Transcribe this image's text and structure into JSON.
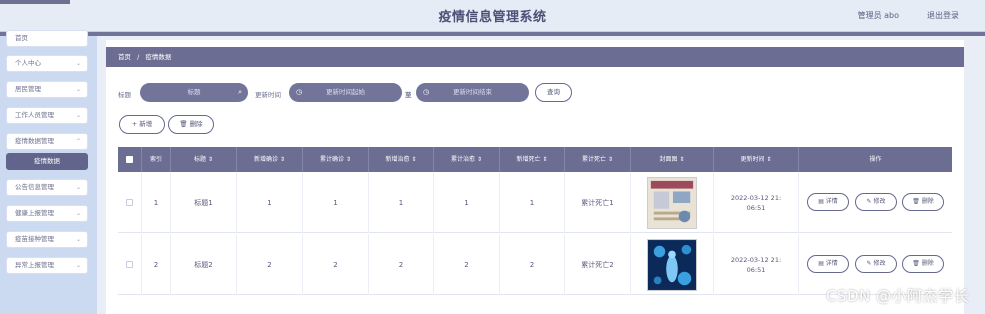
{
  "header": {
    "title": "疫情信息管理系统",
    "admin": "管理员 abo",
    "logout": "退出登录"
  },
  "sidebar": {
    "items": [
      {
        "label": "首页",
        "chev": ""
      },
      {
        "label": "个人中心",
        "chev": "⌄"
      },
      {
        "label": "居民管理",
        "chev": "⌄"
      },
      {
        "label": "工作人员管理",
        "chev": "⌄"
      },
      {
        "label": "疫情数据管理",
        "chev": "⌃"
      },
      {
        "label": "疫情数据",
        "chev": ""
      },
      {
        "label": "公告信息管理",
        "chev": "⌄"
      },
      {
        "label": "健康上报管理",
        "chev": "⌄"
      },
      {
        "label": "疫苗接种管理",
        "chev": "⌄"
      },
      {
        "label": "异常上报管理",
        "chev": "⌄"
      }
    ]
  },
  "breadcrumb": {
    "home": "首页",
    "sep": "/",
    "current": "疫情数据"
  },
  "filter": {
    "title_label": "标题",
    "title_placeholder": "标题",
    "time_label": "更新时间",
    "start_placeholder": "更新时间起始",
    "to": "至",
    "end_placeholder": "更新时间结束",
    "search_label": "查询"
  },
  "actions": {
    "add_label": "+ 新增",
    "delete_label": "🗑 删除"
  },
  "table": {
    "headers": [
      "",
      "索引",
      "标题 ⇕",
      "新增确诊 ⇕",
      "累计确诊 ⇕",
      "新增治愈 ⇕",
      "累计治愈 ⇕",
      "新增死亡 ⇕",
      "累计死亡 ⇕",
      "封面图 ⇕",
      "更新时间 ⇕",
      "操作"
    ],
    "rows": [
      {
        "index": "1",
        "title": "标题1",
        "new_confirmed": "1",
        "total_confirmed": "1",
        "new_cured": "1",
        "total_cured": "1",
        "new_deaths": "1",
        "total_deaths": "累计死亡1",
        "time1": "2022-03-12 21:",
        "time2": "06:51"
      },
      {
        "index": "2",
        "title": "标题2",
        "new_confirmed": "2",
        "total_confirmed": "2",
        "new_cured": "2",
        "total_cured": "2",
        "new_deaths": "2",
        "total_deaths": "累计死亡2",
        "time1": "2022-03-12 21:",
        "time2": "06:51"
      }
    ],
    "ops": {
      "detail": "▤ 详情",
      "edit": "✎ 修改",
      "delete": "🗑 删除"
    }
  },
  "watermark": "CSDN @小阿杰学长"
}
